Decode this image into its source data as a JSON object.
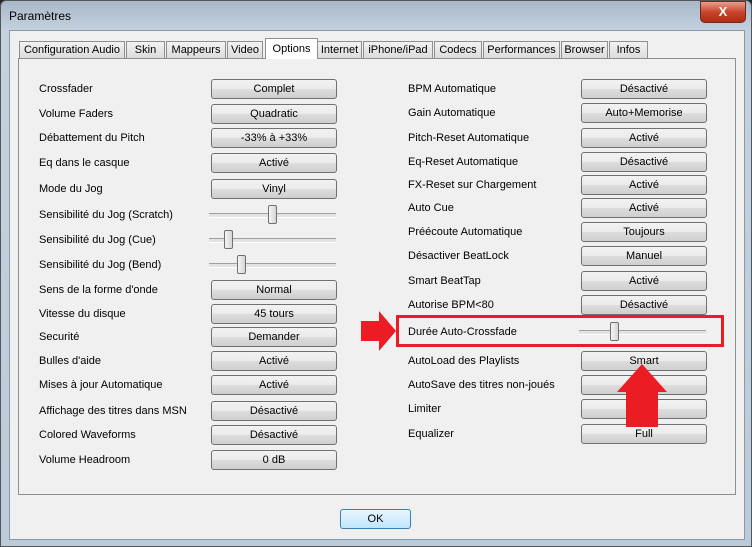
{
  "window": {
    "title": "Paramètres",
    "close_label": "X"
  },
  "tabs": [
    "Configuration Audio",
    "Skin",
    "Mappeurs",
    "Video",
    "Options",
    "Internet",
    "iPhone/iPad",
    "Codecs",
    "Performances",
    "Browser",
    "Infos"
  ],
  "active_tab": "Options",
  "left": [
    {
      "label": "Crossfader",
      "value": "Complet"
    },
    {
      "label": "Volume Faders",
      "value": "Quadratic"
    },
    {
      "label": "Débattement du Pitch",
      "value": "-33% à +33%"
    },
    {
      "label": "Eq dans le casque",
      "value": "Activé"
    },
    {
      "label": "Mode du Jog",
      "value": "Vinyl"
    },
    {
      "label": "Sensibilité du Jog (Scratch)",
      "slider": 0.5
    },
    {
      "label": "Sensibilité du Jog (Cue)",
      "slider": 0.16
    },
    {
      "label": "Sensibilité du Jog (Bend)",
      "slider": 0.26
    },
    {
      "label": "Sens de la forme d'onde",
      "value": "Normal"
    },
    {
      "label": "Vitesse du disque",
      "value": "45 tours"
    },
    {
      "label": "Securité",
      "value": "Demander"
    },
    {
      "label": "Bulles d'aide",
      "value": "Activé"
    },
    {
      "label": "Mises à jour Automatique",
      "value": "Activé"
    },
    {
      "label": "Affichage des titres dans MSN",
      "value": "Désactivé"
    },
    {
      "label": "Colored Waveforms",
      "value": "Désactivé"
    },
    {
      "label": "Volume Headroom",
      "value": "0 dB"
    }
  ],
  "right": [
    {
      "label": "BPM Automatique",
      "value": "Désactivé"
    },
    {
      "label": "Gain Automatique",
      "value": "Auto+Memorise"
    },
    {
      "label": "Pitch-Reset Automatique",
      "value": "Activé"
    },
    {
      "label": "Eq-Reset Automatique",
      "value": "Désactivé"
    },
    {
      "label": "FX-Reset sur Chargement",
      "value": "Activé"
    },
    {
      "label": "Auto Cue",
      "value": "Activé"
    },
    {
      "label": "Préécoute Automatique",
      "value": "Toujours"
    },
    {
      "label": "Désactiver BeatLock",
      "value": "Manuel"
    },
    {
      "label": "Smart BeatTap",
      "value": "Activé"
    },
    {
      "label": "Autorise BPM<80",
      "value": "Désactivé"
    },
    {
      "label": "Durée Auto-Crossfade",
      "slider": 0.28
    },
    {
      "label": "AutoLoad des Playlists",
      "value": "Smart"
    },
    {
      "label": "AutoSave des titres non-joués",
      "value": ""
    },
    {
      "label": "Limiter",
      "value": "é"
    },
    {
      "label": "Equalizer",
      "value": "Full"
    }
  ],
  "ok_label": "OK",
  "colors": {
    "highlight": "#ec1c24"
  }
}
